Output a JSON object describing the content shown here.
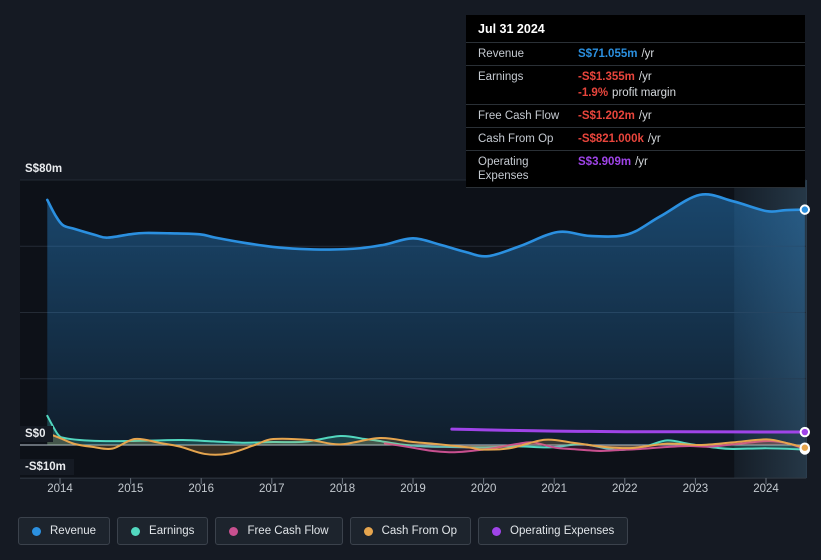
{
  "colors": {
    "revenue": "#2b90e0",
    "earnings": "#52d7bf",
    "free_cash_flow": "#c8508f",
    "cash_from_op": "#e6a54e",
    "operating_expenses": "#9f44e8",
    "negative": "#e8453c",
    "page_background": "#151a23",
    "plot_background": "#0d1118",
    "gridline": "#242b35",
    "zero_line": "#9aa3ad"
  },
  "tooltip": {
    "date": "Jul 31 2024",
    "rows": [
      {
        "label": "Revenue",
        "value": "S$71.055m",
        "suffix": "/yr",
        "color": "revenue"
      },
      {
        "label": "Earnings",
        "value": "-S$1.355m",
        "suffix": "/yr",
        "color": "negative",
        "extra_value": "-1.9%",
        "extra_text": "profit margin"
      },
      {
        "label": "Free Cash Flow",
        "value": "-S$1.202m",
        "suffix": "/yr",
        "color": "negative"
      },
      {
        "label": "Cash From Op",
        "value": "-S$821.000k",
        "suffix": "/yr",
        "color": "negative"
      },
      {
        "label": "Operating Expenses",
        "value": "S$3.909m",
        "suffix": "/yr",
        "color": "operating_expenses"
      }
    ]
  },
  "legend": {
    "items": [
      {
        "label": "Revenue",
        "color": "revenue"
      },
      {
        "label": "Earnings",
        "color": "earnings"
      },
      {
        "label": "Free Cash Flow",
        "color": "free_cash_flow"
      },
      {
        "label": "Cash From Op",
        "color": "cash_from_op"
      },
      {
        "label": "Operating Expenses",
        "color": "operating_expenses"
      }
    ]
  },
  "chart_data": {
    "type": "line",
    "title": "Earnings and Revenue History",
    "x_unit": "year",
    "ylim": [
      -10,
      80
    ],
    "currency_unit": "S$m",
    "x_ticks": [
      2014,
      2015,
      2016,
      2017,
      2018,
      2019,
      2020,
      2021,
      2022,
      2023,
      2024
    ],
    "y_ticks": [
      {
        "label": "S$80m",
        "value": 80
      },
      {
        "label": "S$0",
        "value": 0
      },
      {
        "label": "-S$10m",
        "value": -10
      }
    ],
    "y_gridlines_unlabeled": [
      60,
      40,
      20
    ],
    "highlight_band": {
      "from_x": 2023.55,
      "to_x": 2024.58
    },
    "grid": true,
    "legend_position": "bottom",
    "series": [
      {
        "id": "revenue",
        "name": "Revenue",
        "color": "revenue",
        "width": 2.6,
        "fill": "gradient",
        "end_marker": true,
        "points": [
          [
            2013.82,
            74.0
          ],
          [
            2013.93,
            69.5
          ],
          [
            2014.04,
            66.4
          ],
          [
            2014.21,
            65.2
          ],
          [
            2014.5,
            63.4
          ],
          [
            2014.67,
            62.6
          ],
          [
            2014.99,
            63.6
          ],
          [
            2015.2,
            64.0
          ],
          [
            2015.56,
            63.9
          ],
          [
            2015.98,
            63.6
          ],
          [
            2016.2,
            62.6
          ],
          [
            2016.62,
            61.0
          ],
          [
            2017.02,
            59.8
          ],
          [
            2017.4,
            59.2
          ],
          [
            2017.82,
            59.0
          ],
          [
            2018.25,
            59.4
          ],
          [
            2018.6,
            60.5
          ],
          [
            2019.0,
            62.4
          ],
          [
            2019.38,
            60.5
          ],
          [
            2019.74,
            58.3
          ],
          [
            2020.06,
            57.0
          ],
          [
            2020.51,
            60.0
          ],
          [
            2021.05,
            64.3
          ],
          [
            2021.51,
            63.1
          ],
          [
            2022.04,
            63.6
          ],
          [
            2022.5,
            69.0
          ],
          [
            2023.06,
            75.5
          ],
          [
            2023.53,
            73.6
          ],
          [
            2024.01,
            70.6
          ],
          [
            2024.27,
            70.9
          ],
          [
            2024.55,
            71.055
          ]
        ]
      },
      {
        "id": "earnings",
        "name": "Earnings",
        "color": "earnings",
        "width": 2,
        "fill": 0.2,
        "end_marker": true,
        "points": [
          [
            2013.82,
            8.8
          ],
          [
            2013.97,
            3.2
          ],
          [
            2014.07,
            2.1
          ],
          [
            2014.28,
            1.5
          ],
          [
            2014.57,
            1.2
          ],
          [
            2014.99,
            1.2
          ],
          [
            2015.42,
            1.4
          ],
          [
            2015.74,
            1.5
          ],
          [
            2016.17,
            1.1
          ],
          [
            2016.55,
            0.7
          ],
          [
            2017.02,
            0.9
          ],
          [
            2017.47,
            1.0
          ],
          [
            2017.97,
            2.7
          ],
          [
            2018.32,
            1.8
          ],
          [
            2018.53,
            1.2
          ],
          [
            2018.82,
            0.2
          ],
          [
            2019.14,
            -0.4
          ],
          [
            2019.52,
            -0.6
          ],
          [
            2019.99,
            -0.7
          ],
          [
            2020.47,
            -0.4
          ],
          [
            2020.94,
            -0.7
          ],
          [
            2021.41,
            0.2
          ],
          [
            2021.89,
            -1.5
          ],
          [
            2022.29,
            -0.4
          ],
          [
            2022.6,
            1.4
          ],
          [
            2022.92,
            0.3
          ],
          [
            2023.28,
            -0.8
          ],
          [
            2023.53,
            -1.2
          ],
          [
            2024.01,
            -1.0
          ],
          [
            2024.55,
            -1.355
          ]
        ]
      },
      {
        "id": "free_cash_flow",
        "name": "Free Cash Flow",
        "color": "free_cash_flow",
        "width": 2,
        "fill": 0.18,
        "end_marker": true,
        "points": [
          [
            2018.6,
            0.5
          ],
          [
            2018.82,
            -0.2
          ],
          [
            2019.1,
            -1.2
          ],
          [
            2019.28,
            -1.8
          ],
          [
            2019.59,
            -2.2
          ],
          [
            2019.99,
            -1.4
          ],
          [
            2020.23,
            -0.6
          ],
          [
            2020.47,
            0.3
          ],
          [
            2020.7,
            0.8
          ],
          [
            2021.01,
            -0.8
          ],
          [
            2021.29,
            -1.3
          ],
          [
            2021.65,
            -1.8
          ],
          [
            2021.93,
            -1.5
          ],
          [
            2022.22,
            -1.2
          ],
          [
            2022.6,
            -0.6
          ],
          [
            2022.92,
            -0.3
          ],
          [
            2023.2,
            -0.5
          ],
          [
            2023.53,
            0.2
          ],
          [
            2023.84,
            0.9
          ],
          [
            2024.05,
            1.2
          ],
          [
            2024.31,
            0.5
          ],
          [
            2024.55,
            -1.202
          ]
        ]
      },
      {
        "id": "cash_from_op",
        "name": "Cash From Op",
        "color": "cash_from_op",
        "width": 2,
        "fill": 0.2,
        "end_marker": true,
        "points": [
          [
            2013.82,
            3.6
          ],
          [
            2014.0,
            2.1
          ],
          [
            2014.21,
            0.3
          ],
          [
            2014.47,
            -0.6
          ],
          [
            2014.74,
            -1.1
          ],
          [
            2015.06,
            1.8
          ],
          [
            2015.42,
            0.6
          ],
          [
            2015.7,
            -0.5
          ],
          [
            2016.05,
            -2.7
          ],
          [
            2016.38,
            -2.6
          ],
          [
            2016.76,
            0.0
          ],
          [
            2017.02,
            1.8
          ],
          [
            2017.54,
            1.5
          ],
          [
            2017.97,
            0.2
          ],
          [
            2018.53,
            2.1
          ],
          [
            2019.0,
            0.9
          ],
          [
            2019.38,
            0.2
          ],
          [
            2019.81,
            -0.8
          ],
          [
            2019.99,
            -1.4
          ],
          [
            2020.37,
            -1.0
          ],
          [
            2020.87,
            1.6
          ],
          [
            2021.29,
            0.6
          ],
          [
            2021.72,
            -0.6
          ],
          [
            2022.11,
            -0.9
          ],
          [
            2022.6,
            0.4
          ],
          [
            2023.06,
            0.0
          ],
          [
            2023.53,
            0.8
          ],
          [
            2024.01,
            1.7
          ],
          [
            2024.31,
            0.5
          ],
          [
            2024.55,
            -0.821
          ]
        ]
      },
      {
        "id": "operating_expenses",
        "name": "Operating Expenses",
        "color": "operating_expenses",
        "width": 3,
        "fill": 0,
        "end_marker": true,
        "points": [
          [
            2019.55,
            4.8
          ],
          [
            2019.95,
            4.6
          ],
          [
            2020.4,
            4.4
          ],
          [
            2021.0,
            4.2
          ],
          [
            2021.5,
            4.1
          ],
          [
            2022.0,
            4.0
          ],
          [
            2022.7,
            4.0
          ],
          [
            2023.5,
            3.95
          ],
          [
            2024.55,
            3.909
          ]
        ]
      }
    ]
  }
}
